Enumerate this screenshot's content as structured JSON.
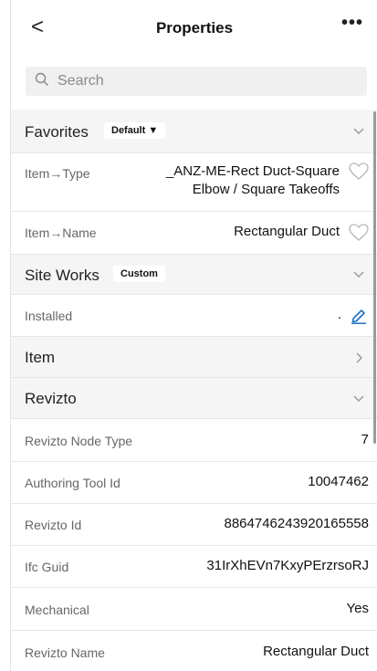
{
  "header": {
    "back_glyph": "<",
    "title": "Properties",
    "more_glyph": "•••"
  },
  "search": {
    "placeholder": "Search"
  },
  "sections": {
    "favorites": {
      "label": "Favorites",
      "chip": "Default ▼"
    },
    "site_works": {
      "label": "Site Works",
      "chip": "Custom"
    },
    "item": {
      "label": "Item"
    },
    "revizto": {
      "label": "Revizto"
    }
  },
  "rows": {
    "item_type": {
      "label": "Item→Type",
      "value_line1": "_ANZ-ME-Rect Duct-Square",
      "value_line2": "Elbow / Square Takeoffs"
    },
    "item_name": {
      "label": "Item→Name",
      "value": "Rectangular Duct"
    },
    "installed": {
      "label": "Installed",
      "value": "."
    },
    "revizto_node_type": {
      "label": "Revizto Node Type",
      "value": "7"
    },
    "authoring_tool_id": {
      "label": "Authoring Tool Id",
      "value": "10047462"
    },
    "revizto_id": {
      "label": "Revizto Id",
      "value": "8864746243920165558"
    },
    "ifc_guid": {
      "label": "Ifc Guid",
      "value": "31IrXhEVn7KxyPErzrsoRJ"
    },
    "mechanical": {
      "label": "Mechanical",
      "value": "Yes"
    },
    "revizto_name": {
      "label": "Revizto Name",
      "value": "Rectangular Duct"
    }
  },
  "colors": {
    "accent": "#1a73c8",
    "section_bg": "#f5f5f5",
    "divider": "#e6e6e6"
  },
  "icons": [
    "back-icon",
    "more-icon",
    "search-icon",
    "chevron-down-icon",
    "chevron-right-icon",
    "heart-icon",
    "pencil-icon"
  ]
}
